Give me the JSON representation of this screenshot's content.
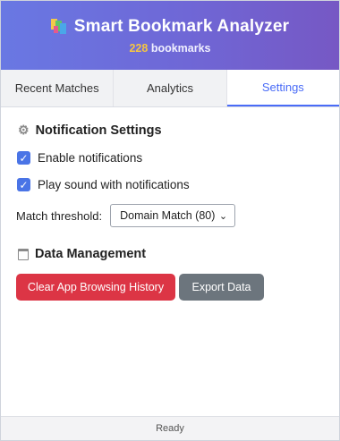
{
  "header": {
    "title": "Smart Bookmark Analyzer",
    "count": "228",
    "count_label": "bookmarks",
    "logo_icon": "bookmarks-logo-icon"
  },
  "tabs": [
    {
      "label": "Recent Matches",
      "active": false
    },
    {
      "label": "Analytics",
      "active": false
    },
    {
      "label": "Settings",
      "active": true
    }
  ],
  "notification_settings": {
    "heading": "Notification Settings",
    "icon": "gear-icon",
    "enable_label": "Enable notifications",
    "enable_checked": true,
    "sound_label": "Play sound with notifications",
    "sound_checked": true,
    "threshold_label": "Match threshold:",
    "threshold_value": "Domain Match (80)"
  },
  "data_management": {
    "heading": "Data Management",
    "icon": "trash-icon",
    "clear_label": "Clear App Browsing History",
    "export_label": "Export Data"
  },
  "status": "Ready",
  "colors": {
    "accent": "#4a6cf7",
    "danger": "#dc3545",
    "secondary": "#6c757d",
    "count_highlight": "#f5c542"
  }
}
